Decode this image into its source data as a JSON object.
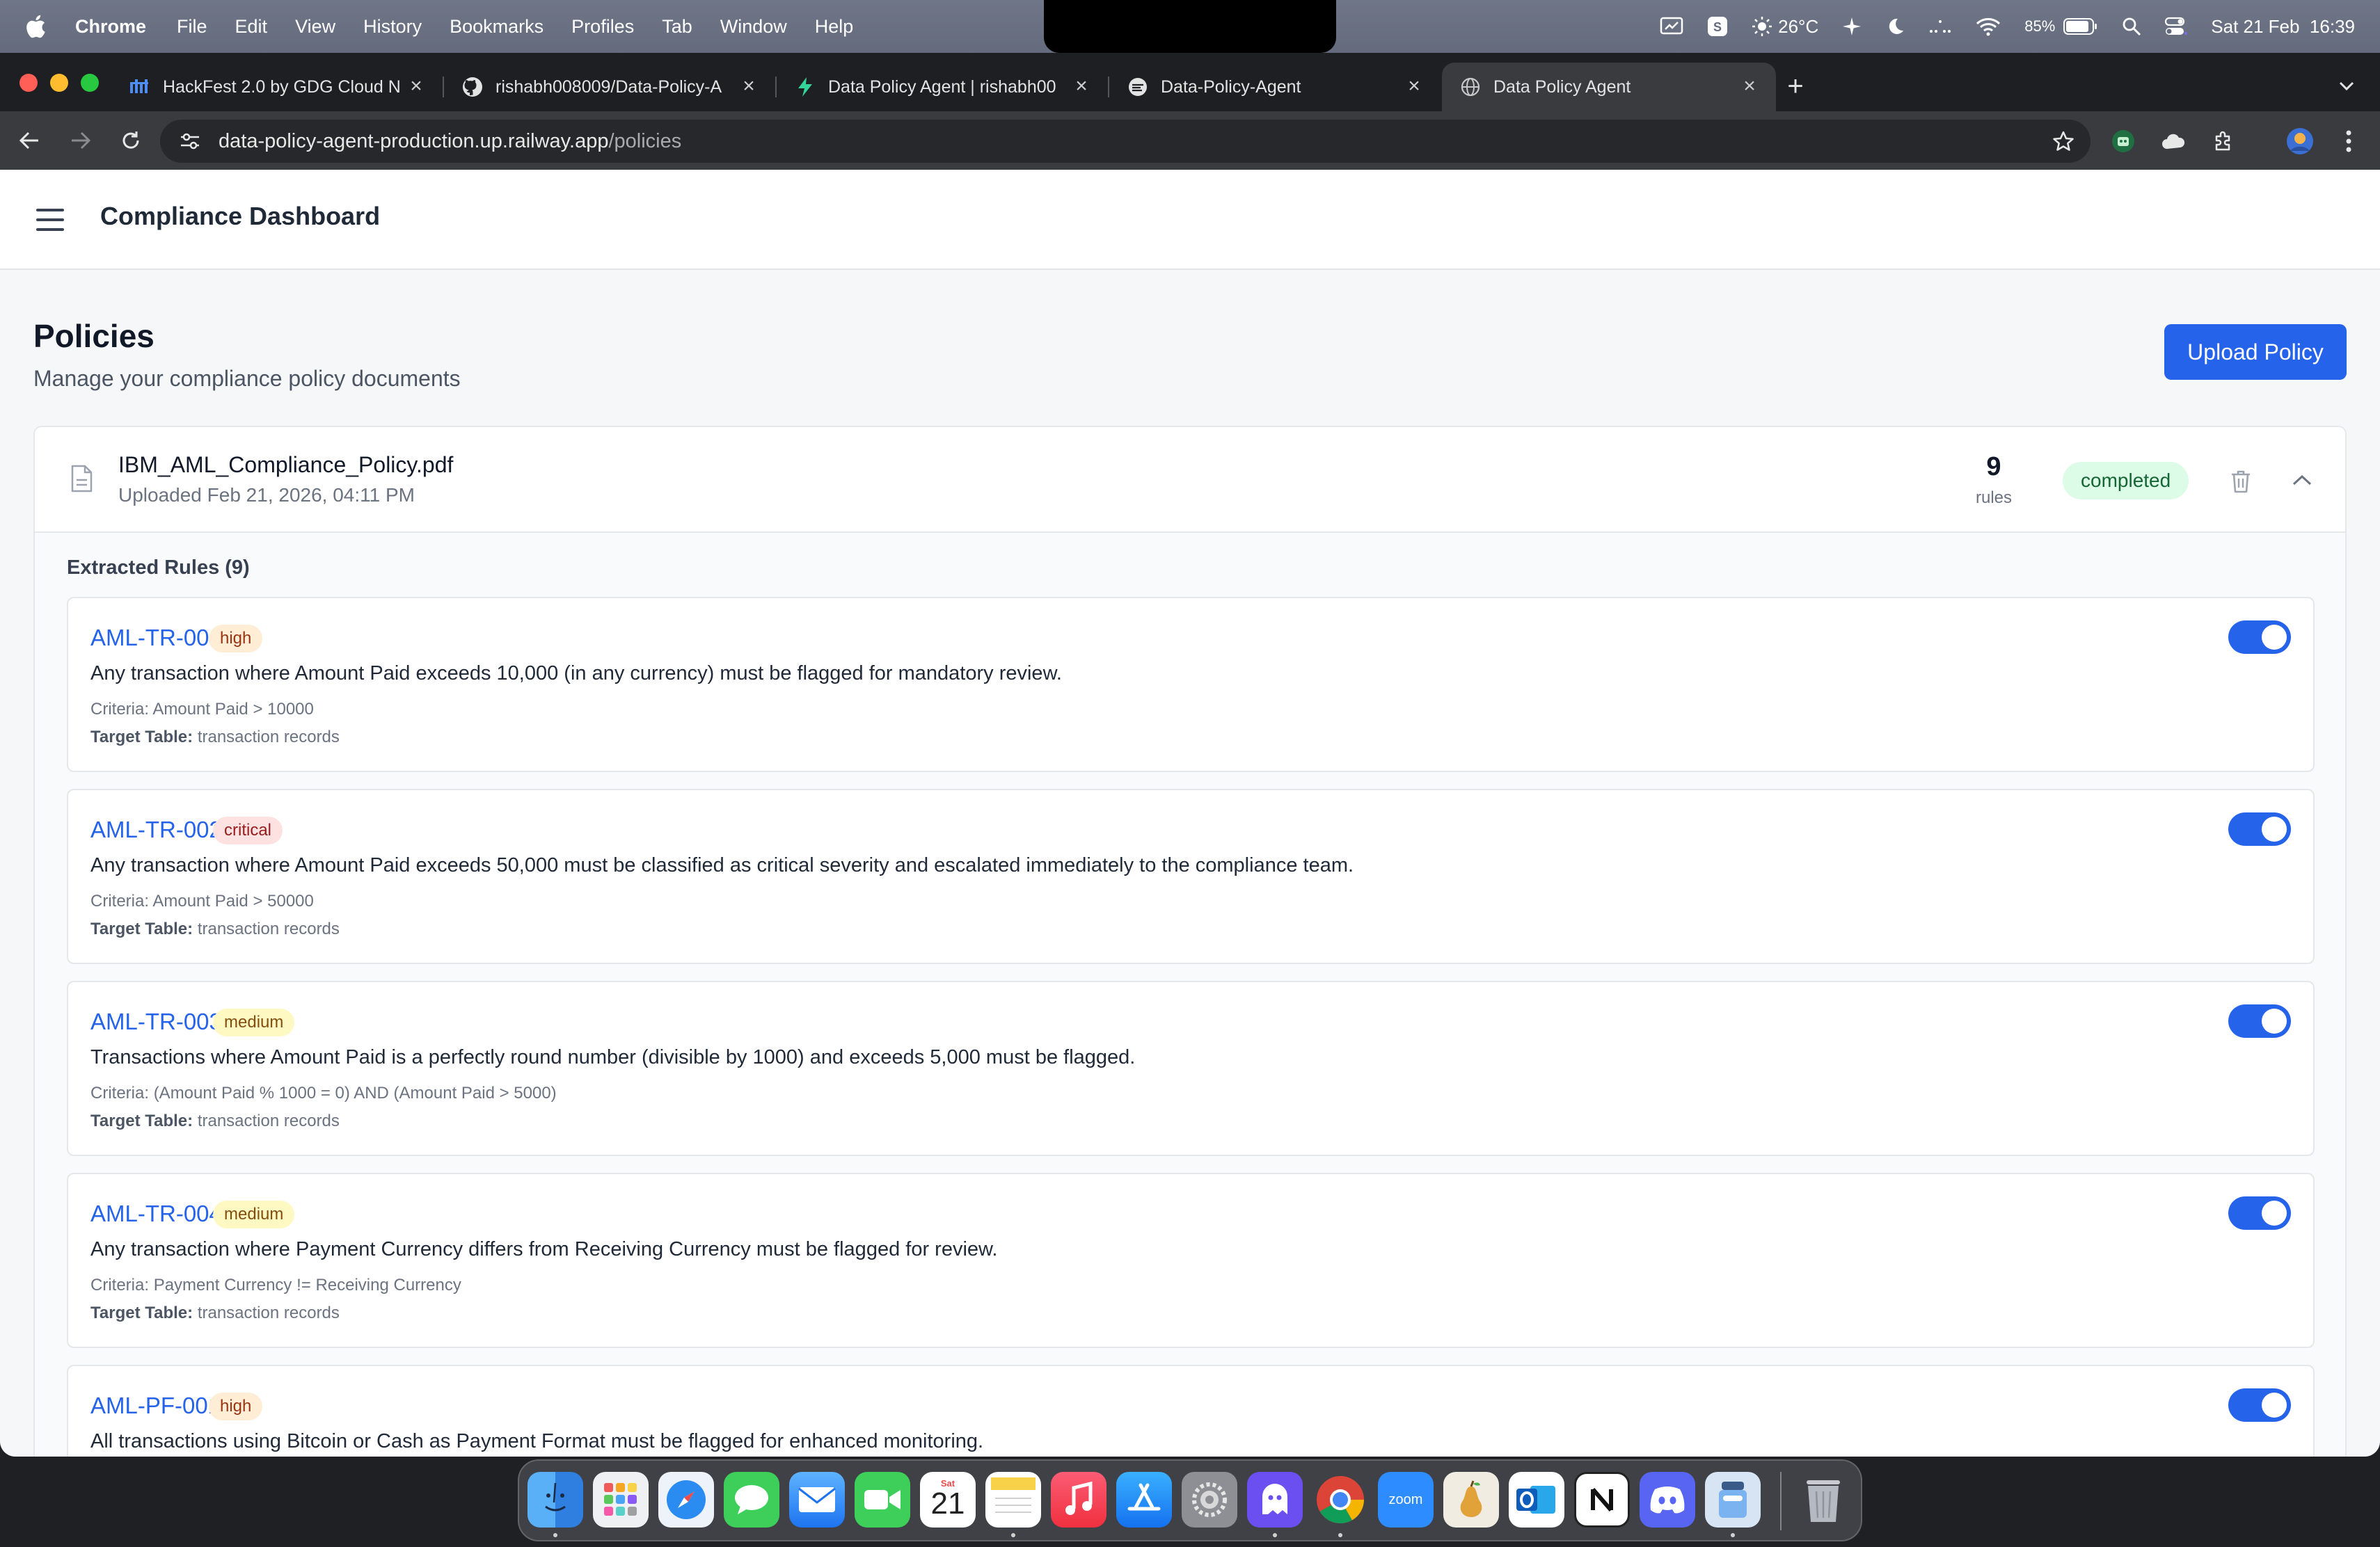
{
  "menubar": {
    "app_name": "Chrome",
    "items": [
      "File",
      "Edit",
      "View",
      "History",
      "Bookmarks",
      "Profiles",
      "Tab",
      "Window",
      "Help"
    ],
    "weather": "26°C",
    "battery": "85%",
    "datetime": "Sat 21 Feb  16:39"
  },
  "browser": {
    "tabs": [
      {
        "title": "HackFest 2.0 by GDG Cloud N",
        "icon": "hackfest-favicon"
      },
      {
        "title": "rishabh008009/Data-Policy-A",
        "icon": "github-favicon"
      },
      {
        "title": "Data Policy Agent | rishabh00",
        "icon": "railway-favicon"
      },
      {
        "title": "Data-Policy-Agent",
        "icon": "app-favicon"
      },
      {
        "title": "Data Policy Agent",
        "icon": "globe-favicon"
      }
    ],
    "url_host": "data-policy-agent-production.up.railway.app",
    "url_path": "/policies"
  },
  "app": {
    "header_title": "Compliance Dashboard",
    "page_title": "Policies",
    "page_subtitle": "Manage your compliance policy documents",
    "upload_label": "Upload Policy"
  },
  "policy": {
    "filename": "IBM_AML_Compliance_Policy.pdf",
    "uploaded": "Uploaded Feb 21, 2026, 04:11 PM",
    "rule_count": "9",
    "rule_count_label": "rules",
    "status": "completed",
    "rules_heading": "Extracted Rules (9)",
    "criteria_label": "Criteria:",
    "target_label": "Target Table:",
    "rules": [
      {
        "id": "AML-TR-001",
        "severity": "high",
        "description": "Any transaction where Amount Paid exceeds 10,000 (in any currency) must be flagged for mandatory review.",
        "criteria": "Amount Paid > 10000",
        "target": "transaction records",
        "enabled": true
      },
      {
        "id": "AML-TR-002",
        "severity": "critical",
        "description": "Any transaction where Amount Paid exceeds 50,000 must be classified as critical severity and escalated immediately to the compliance team.",
        "criteria": "Amount Paid > 50000",
        "target": "transaction records",
        "enabled": true
      },
      {
        "id": "AML-TR-003",
        "severity": "medium",
        "description": "Transactions where Amount Paid is a perfectly round number (divisible by 1000) and exceeds 5,000 must be flagged.",
        "criteria": "(Amount Paid % 1000 = 0) AND (Amount Paid > 5000)",
        "target": "transaction records",
        "enabled": true
      },
      {
        "id": "AML-TR-004",
        "severity": "medium",
        "description": "Any transaction where Payment Currency differs from Receiving Currency must be flagged for review.",
        "criteria": "Payment Currency != Receiving Currency",
        "target": "transaction records",
        "enabled": true
      },
      {
        "id": "AML-PF-001",
        "severity": "high",
        "description": "All transactions using Bitcoin or Cash as Payment Format must be flagged for enhanced monitoring.",
        "criteria": "",
        "target": "",
        "enabled": true
      }
    ]
  },
  "dock": {
    "apps": [
      "finder",
      "launchpad",
      "safari",
      "messages",
      "mail",
      "facetime",
      "calendar",
      "notes",
      "music",
      "app-store",
      "system-settings",
      "ghost",
      "chrome",
      "zoom",
      "pear",
      "outlook",
      "notion",
      "discord",
      "preview",
      "trash"
    ],
    "calendar_day": "21",
    "calendar_weekday": "Sat",
    "zoom_label": "zoom"
  }
}
